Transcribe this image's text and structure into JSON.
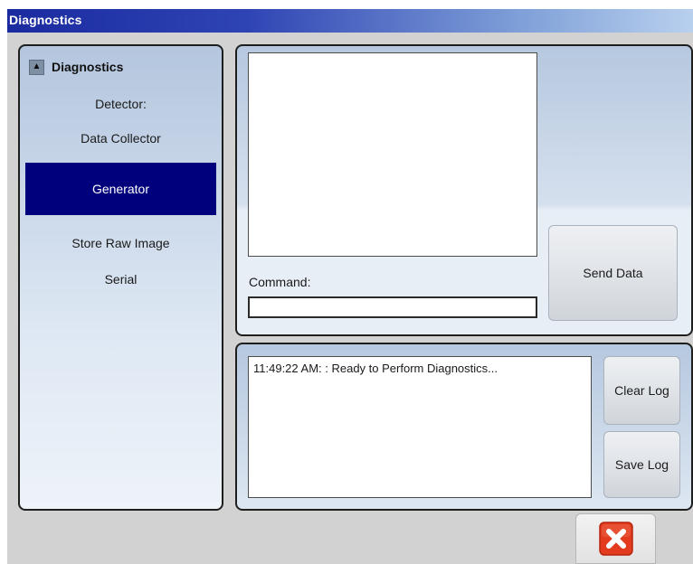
{
  "window": {
    "title": "Diagnostics"
  },
  "sidebar": {
    "section_title": "Diagnostics",
    "collapse_icon": "chevron-up-icon",
    "items": [
      {
        "label": "Detector:"
      },
      {
        "label": "Data Collector"
      },
      {
        "label": "Generator",
        "selected": true
      },
      {
        "label": "Store Raw Image"
      },
      {
        "label": "Serial"
      }
    ]
  },
  "command_panel": {
    "command_label": "Command:",
    "command_value": "",
    "send_button": "Send Data"
  },
  "log_panel": {
    "log_text": "11:49:22 AM: : Ready to Perform Diagnostics...",
    "clear_button": "Clear Log",
    "save_button": "Save Log"
  },
  "footer": {
    "close_icon": "close-icon"
  },
  "colors": {
    "selected_bg": "#00007c",
    "close_icon_bg": "#e23b1e",
    "title_bar_start": "#1a2ba0"
  }
}
